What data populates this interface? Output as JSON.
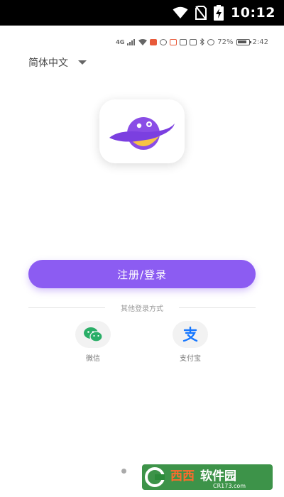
{
  "system_status": {
    "time": "10:12",
    "icons": [
      "wifi-icon",
      "no-sim-icon",
      "battery-charging-icon"
    ]
  },
  "app_status": {
    "network": "4G",
    "battery_percent": "72%",
    "time": "2:42",
    "icons": [
      "signal-icon",
      "wifi-icon",
      "notification-icon",
      "eye-icon",
      "nfc-icon",
      "bluetooth-icon",
      "alarm-icon",
      "vibrate-icon",
      "battery-icon"
    ]
  },
  "language": {
    "label": "简体中文",
    "icon": "caret-down-icon"
  },
  "logo": {
    "icon": "planet-logo-icon",
    "colors": {
      "planet": "#8a4de6",
      "ring": "#7b3fe0",
      "face": "#f6c445"
    }
  },
  "main_button": {
    "label": "注册/登录",
    "color": "#8c5cf2"
  },
  "other_login": {
    "title": "其他登录方式",
    "options": [
      {
        "label": "微信",
        "icon": "wechat-icon",
        "color": "#2aae67"
      },
      {
        "label": "支付宝",
        "icon": "alipay-icon",
        "color": "#1677ff"
      }
    ]
  },
  "watermark": {
    "text": "西西软件园",
    "sub": "CR173.com"
  }
}
